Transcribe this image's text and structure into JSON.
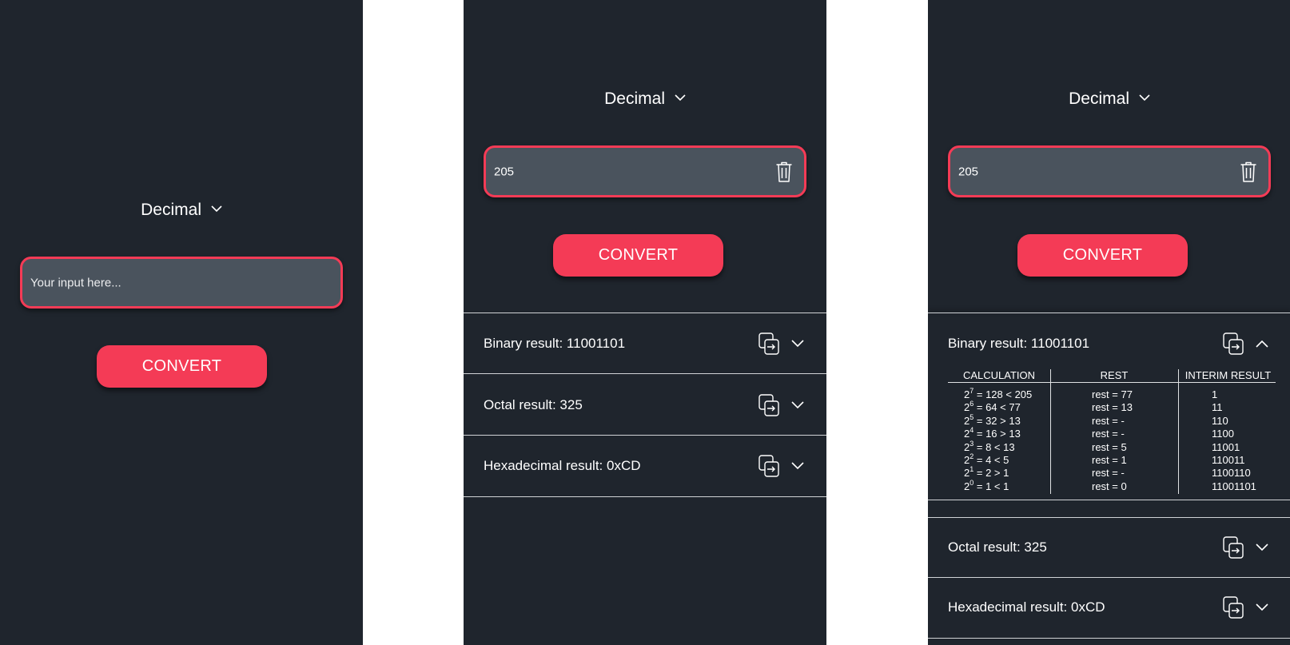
{
  "screens": [
    {
      "selector": "Decimal",
      "input_placeholder": "Your input here...",
      "convert_label": "CONVERT"
    },
    {
      "selector": "Decimal",
      "input_value": "205",
      "convert_label": "CONVERT",
      "results": [
        {
          "label": "Binary result: 11001101"
        },
        {
          "label": "Octal result: 325"
        },
        {
          "label": "Hexadecimal result: 0xCD"
        }
      ]
    },
    {
      "selector": "Decimal",
      "input_value": "205",
      "convert_label": "CONVERT",
      "results": [
        {
          "label": "Binary result: 11001101",
          "expanded": true
        },
        {
          "label": "Octal result: 325"
        },
        {
          "label": "Hexadecimal result: 0xCD"
        }
      ],
      "table": {
        "headers": [
          "CALCULATION",
          "REST",
          "INTERIM RESULT"
        ],
        "rows": [
          {
            "base": "2",
            "exp": "7",
            "expr": " = 128 < 205",
            "rest": "rest = 77",
            "interim": "1"
          },
          {
            "base": "2",
            "exp": "6",
            "expr": " = 64 < 77",
            "rest": "rest = 13",
            "interim": "11"
          },
          {
            "base": "2",
            "exp": "5",
            "expr": " = 32 > 13",
            "rest": "rest = -",
            "interim": "110"
          },
          {
            "base": "2",
            "exp": "4",
            "expr": " = 16 > 13",
            "rest": "rest = -",
            "interim": "1100"
          },
          {
            "base": "2",
            "exp": "3",
            "expr": " = 8 < 13",
            "rest": "rest = 5",
            "interim": "11001"
          },
          {
            "base": "2",
            "exp": "2",
            "expr": " = 4 < 5",
            "rest": "rest = 1",
            "interim": "110011"
          },
          {
            "base": "2",
            "exp": "1",
            "expr": " = 2 > 1",
            "rest": "rest = -",
            "interim": "1100110"
          },
          {
            "base": "2",
            "exp": "0",
            "expr": " = 1 < 1",
            "rest": "rest = 0",
            "interim": "11001101"
          }
        ]
      }
    }
  ],
  "icons": {
    "chevron_down": "chevron-down-icon",
    "chevron_up": "chevron-up-icon",
    "trash": "trash-icon",
    "copy": "copy-icon"
  },
  "colors": {
    "background": "#1f252d",
    "input_fill": "#4a535d",
    "accent": "#f43b56",
    "text": "#ffffff"
  }
}
